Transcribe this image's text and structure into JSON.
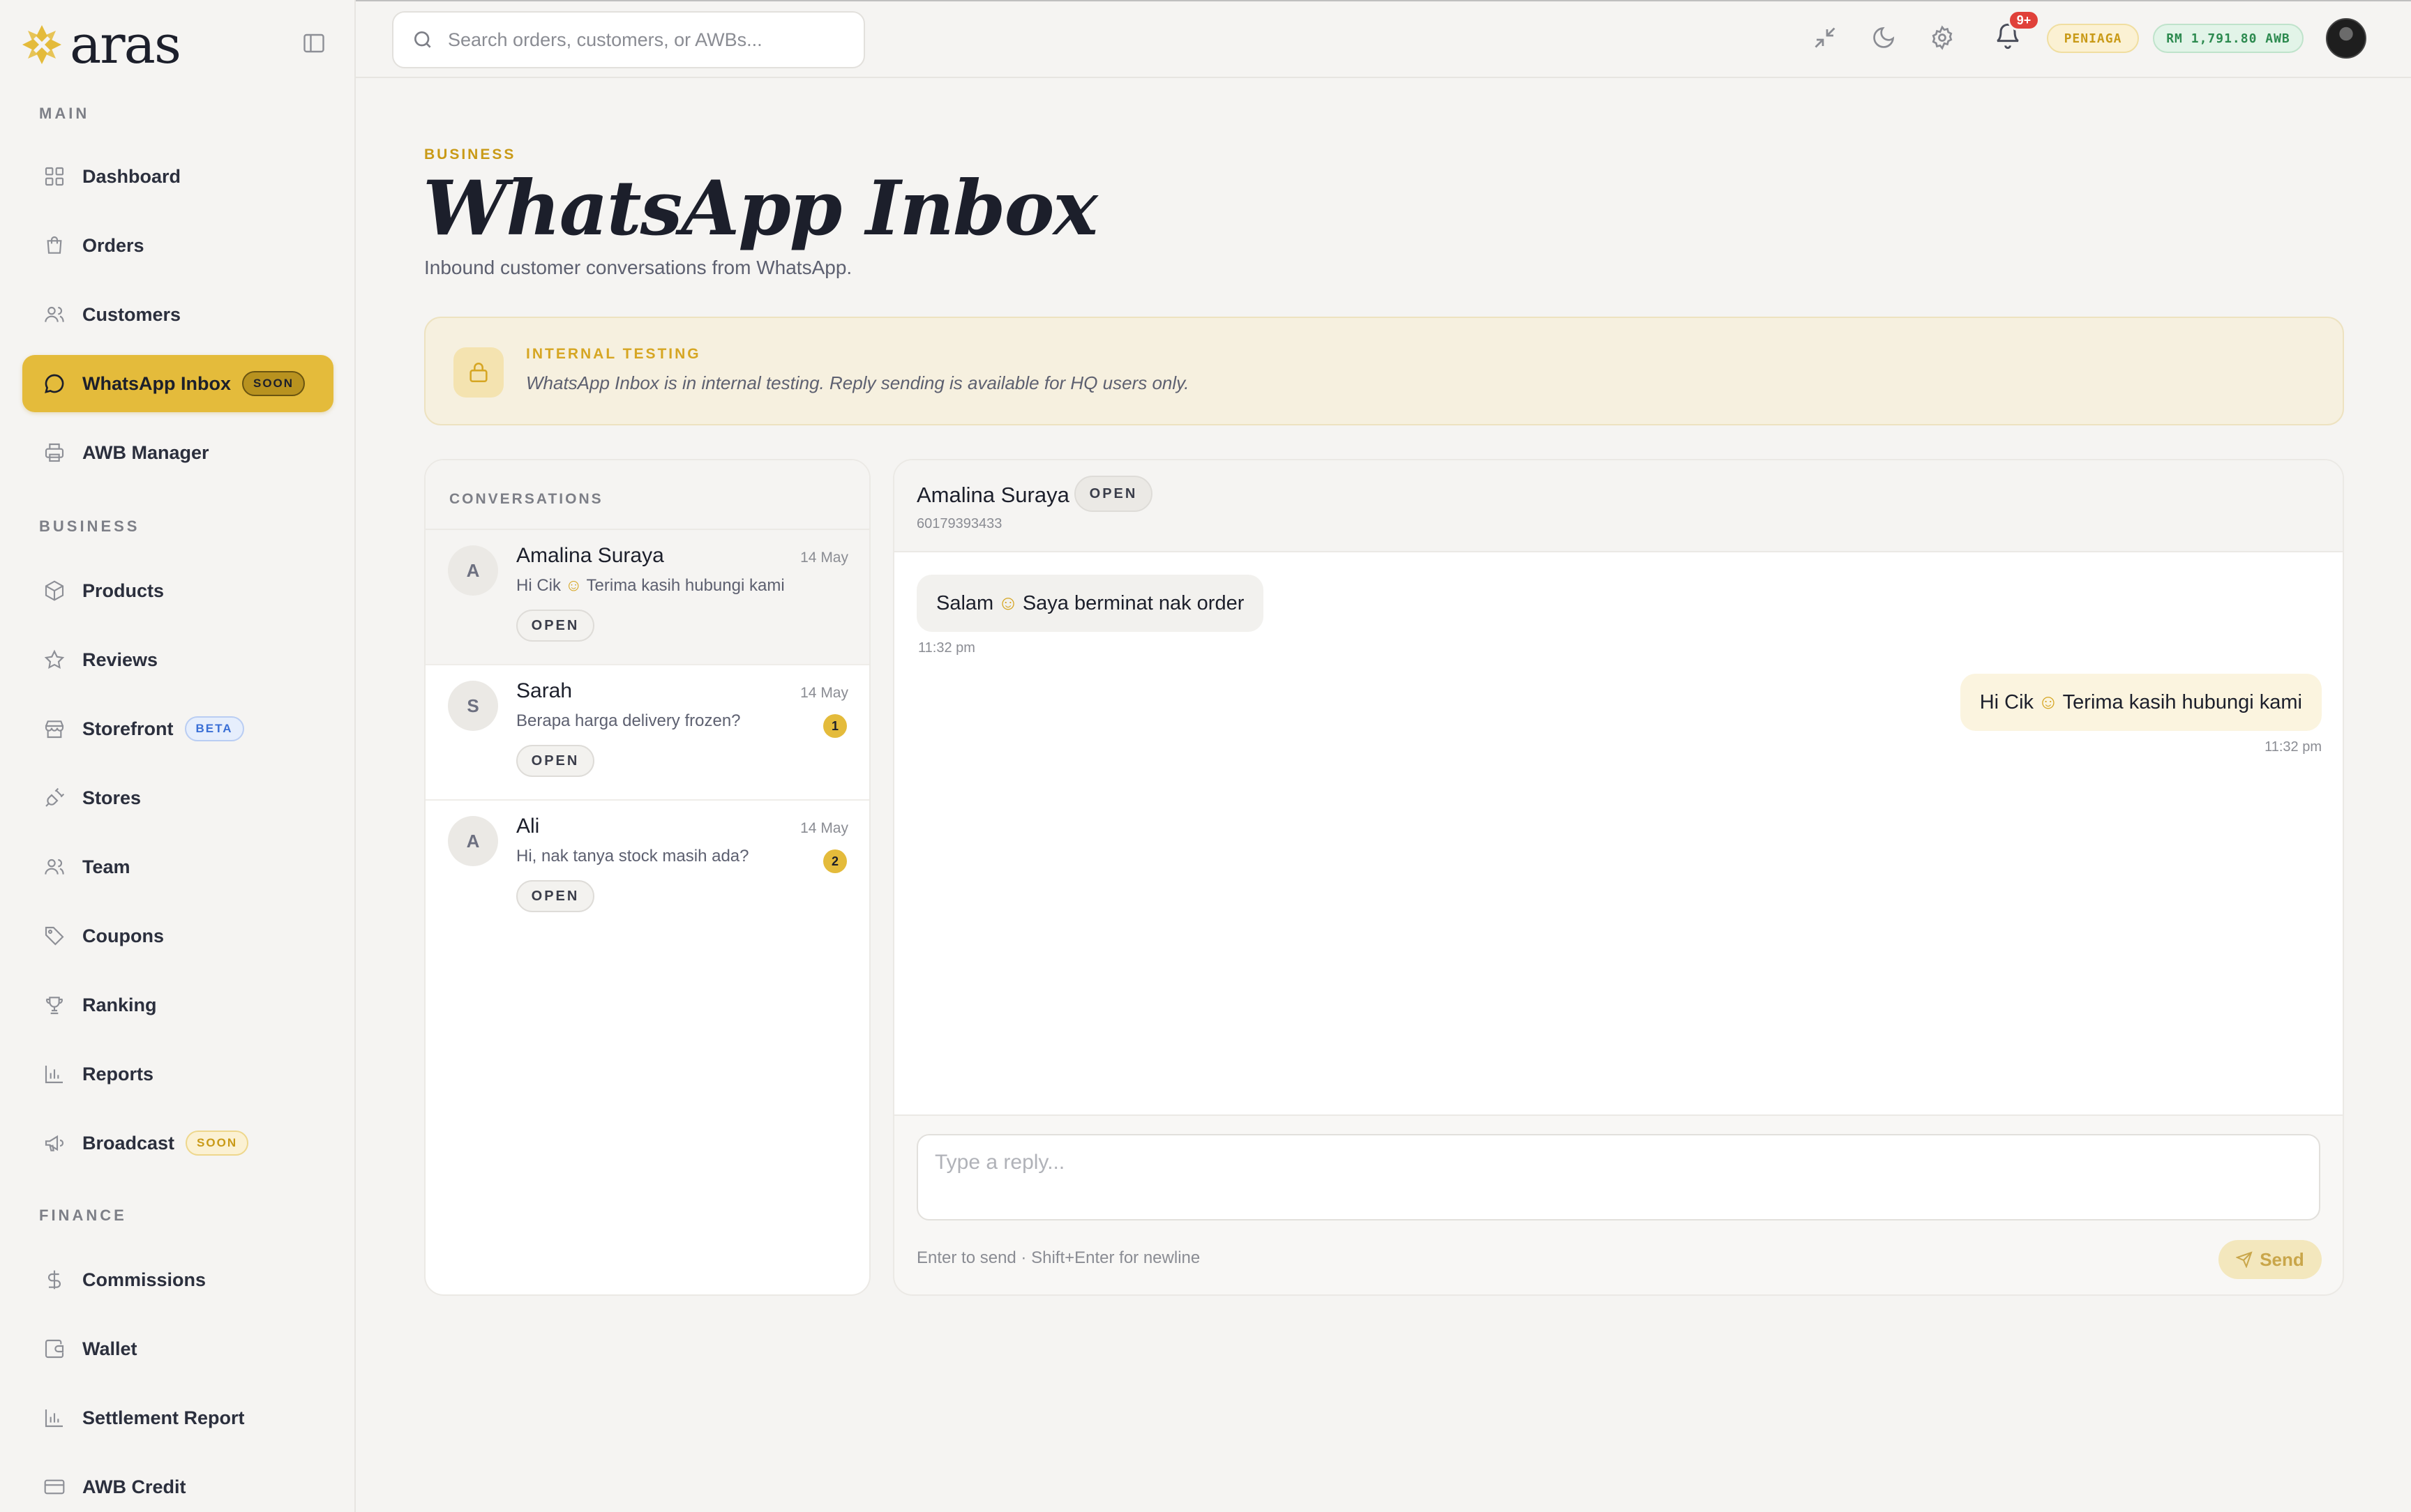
{
  "brand": {
    "name": "aras"
  },
  "sidebar": {
    "sections": [
      {
        "title": "MAIN",
        "items": [
          {
            "label": "Dashboard",
            "icon": "grid-icon"
          },
          {
            "label": "Orders",
            "icon": "bag-icon"
          },
          {
            "label": "Customers",
            "icon": "users-icon"
          },
          {
            "label": "WhatsApp Inbox",
            "icon": "chat-icon",
            "badge": "SOON",
            "active": true
          },
          {
            "label": "AWB Manager",
            "icon": "printer-icon"
          }
        ]
      },
      {
        "title": "BUSINESS",
        "items": [
          {
            "label": "Products",
            "icon": "box-icon"
          },
          {
            "label": "Reviews",
            "icon": "star-icon"
          },
          {
            "label": "Storefront",
            "icon": "store-icon",
            "badge": "BETA"
          },
          {
            "label": "Stores",
            "icon": "plug-icon"
          },
          {
            "label": "Team",
            "icon": "users-icon"
          },
          {
            "label": "Coupons",
            "icon": "tag-icon"
          },
          {
            "label": "Ranking",
            "icon": "trophy-icon"
          },
          {
            "label": "Reports",
            "icon": "bar-chart-icon"
          },
          {
            "label": "Broadcast",
            "icon": "megaphone-icon",
            "badge": "SOON"
          }
        ]
      },
      {
        "title": "FINANCE",
        "items": [
          {
            "label": "Commissions",
            "icon": "dollar-icon"
          },
          {
            "label": "Wallet",
            "icon": "wallet-icon"
          },
          {
            "label": "Settlement Report",
            "icon": "bar-chart-icon"
          },
          {
            "label": "AWB Credit",
            "icon": "credit-card-icon"
          }
        ]
      }
    ]
  },
  "topbar": {
    "search_placeholder": "Search orders, customers, or AWBs...",
    "notification_count": "9+",
    "role_chip": "PENIAGA",
    "balance_chip": "RM 1,791.80 AWB"
  },
  "header": {
    "eyebrow": "BUSINESS",
    "title": "WhatsApp Inbox",
    "subtitle": "Inbound customer conversations from WhatsApp."
  },
  "banner": {
    "title": "INTERNAL TESTING",
    "text": "WhatsApp Inbox is in internal testing. Reply sending is available for HQ users only."
  },
  "conversations": {
    "title": "CONVERSATIONS",
    "items": [
      {
        "initial": "A",
        "name": "Amalina Suraya",
        "date": "14 May",
        "preview_before": "Hi Cik",
        "preview_after": "Terima kasih hubungi kami",
        "status": "OPEN",
        "unread": ""
      },
      {
        "initial": "S",
        "name": "Sarah",
        "date": "14 May",
        "preview": "Berapa harga delivery frozen?",
        "status": "OPEN",
        "unread": "1"
      },
      {
        "initial": "A",
        "name": "Ali",
        "date": "14 May",
        "preview": "Hi, nak tanya stock masih ada?",
        "status": "OPEN",
        "unread": "2"
      }
    ]
  },
  "chat": {
    "name": "Amalina Suraya",
    "status": "OPEN",
    "phone": "60179393433",
    "messages": [
      {
        "direction": "in",
        "before": "Salam",
        "after": "Saya berminat nak order",
        "time": "11:32 pm"
      },
      {
        "direction": "out",
        "before": "Hi Cik",
        "after": "Terima kasih hubungi kami",
        "time": "11:32 pm"
      }
    ],
    "reply_placeholder": "Type a reply...",
    "hint": "Enter to send · Shift+Enter for newline",
    "send_label": "Send"
  }
}
